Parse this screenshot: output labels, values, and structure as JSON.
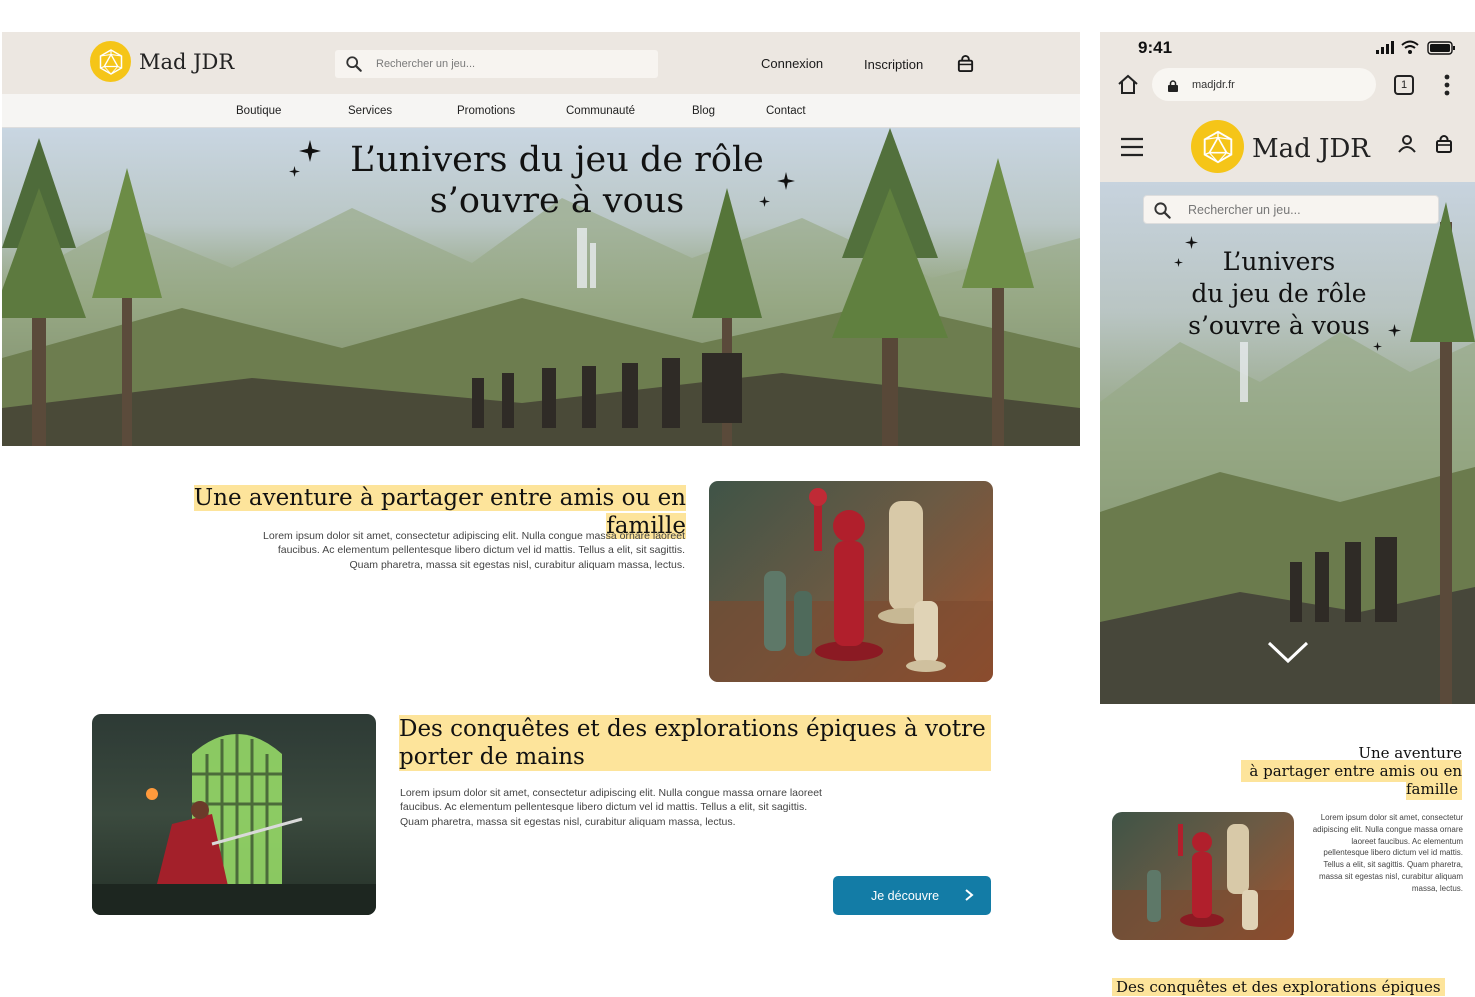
{
  "desktop": {
    "brand": "Mad JDR",
    "search_placeholder": "Rechercher un jeu...",
    "login_label": "Connexion",
    "signup_label": "Inscription",
    "nav": [
      "Boutique",
      "Services",
      "Promotions",
      "Communauté",
      "Blog",
      "Contact"
    ],
    "hero_line1": "L’univers du jeu de rôle",
    "hero_line2": "s’ouvre à vous",
    "section1": {
      "title": "Une aventure à partager entre amis ou en famille",
      "body": "Lorem ipsum dolor sit amet, consectetur adipiscing elit. Nulla congue massa ornare laoreet faucibus. Ac elementum pellentesque libero dictum vel id mattis. Tellus a elit, sit sagittis. Quam pharetra, massa sit egestas nisl, curabitur aliquam massa, lectus."
    },
    "section2": {
      "title_line1": "Des conquêtes et des explorations épiques à votre",
      "title_line2": "porter de mains",
      "body": "Lorem ipsum dolor sit amet, consectetur adipiscing elit. Nulla congue massa ornare laoreet faucibus. Ac elementum pellentesque libero dictum vel id mattis. Tellus a elit, sit sagittis. Quam pharetra, massa sit egestas nisl, curabitur aliquam massa, lectus.",
      "cta_label": "Je découvre"
    }
  },
  "mobile": {
    "time": "9:41",
    "url": "madjdr.fr",
    "tab_count": "1",
    "brand": "Mad JDR",
    "search_placeholder": "Rechercher un jeu...",
    "hero_line1": "L’univers",
    "hero_line2": "du jeu de rôle",
    "hero_line3": "s’ouvre à vous",
    "section1_line1": "Une aventure",
    "section1_line2": "à partager entre amis ou en famille",
    "section1_body": "Lorem ipsum dolor sit amet, consectetur adipiscing elit. Nulla congue massa ornare laoreet faucibus. Ac elementum pellentesque libero dictum vel id mattis. Tellus a elit, sit sagittis. Quam pharetra, massa sit egestas nisl, curabitur aliquam massa, lectus.",
    "section2_title": "Des conquêtes et des explorations épiques"
  },
  "colors": {
    "header_bg": "#ece7e1",
    "logo_yellow": "#f5c518",
    "highlight": "#fde49b",
    "cta_blue": "#137ca6"
  },
  "icons": [
    "d20-logo-icon",
    "search-icon",
    "shopping-bag-icon",
    "sparkle-icon",
    "chevron-right-icon",
    "home-icon",
    "lock-icon",
    "tabs-icon",
    "more-vertical-icon",
    "menu-icon",
    "user-icon",
    "chevron-down-icon",
    "signal-icon",
    "wifi-icon",
    "battery-icon"
  ]
}
